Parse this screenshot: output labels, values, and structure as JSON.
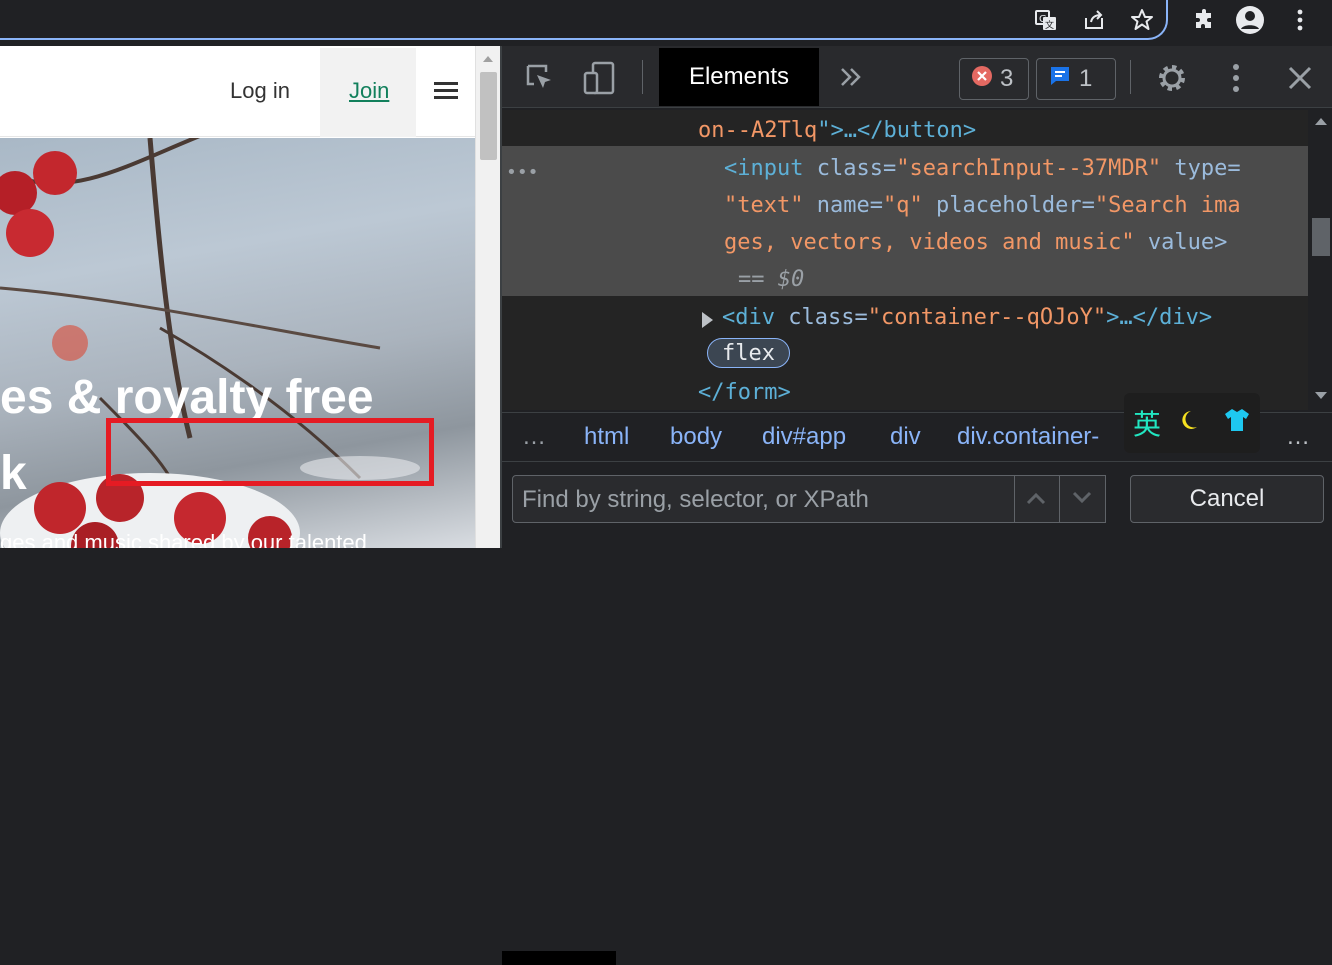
{
  "browser": {
    "icons": [
      "translate-icon",
      "share-icon",
      "bookmark-star-icon",
      "extensions-icon",
      "profile-icon",
      "menu-dots-icon"
    ]
  },
  "page": {
    "nav": {
      "login": "Log in",
      "join": "Join"
    },
    "hero": {
      "title": "es & royalty free",
      "title2": "k",
      "subtitle": "ges and music shared by our talented"
    }
  },
  "devtools": {
    "tabs": {
      "elements": "Elements"
    },
    "errors": {
      "count": "3"
    },
    "messages": {
      "count": "1"
    },
    "dom": {
      "line1": {
        "value": "on--A2Tlq",
        "close": ">…</button>"
      },
      "input": {
        "open": "<input",
        "attr_class": "class",
        "val_class": "\"searchInput--37MDR\"",
        "attr_type": "type=",
        "val_type": "\"text\"",
        "attr_name": "name=",
        "val_name": "\"q\"",
        "attr_placeholder": "placeholder=",
        "val_placeholder_1": "\"Search ima",
        "val_placeholder_2": "ges, vectors, videos and music\"",
        "attr_value": "value>",
        "eq": "== $0"
      },
      "div": {
        "open": "<div",
        "attr_class": "class=",
        "val_class": "\"container--qOJoY\"",
        "close": ">…</div>"
      },
      "flex_badge": "flex",
      "form_close": "</form>",
      "dots": "•••"
    },
    "breadcrumbs": [
      "html",
      "body",
      "div#app",
      "div",
      "div.container-"
    ],
    "find": {
      "placeholder": "Find by string, selector, or XPath",
      "cancel": "Cancel"
    },
    "ime": {
      "lang": "英"
    }
  }
}
